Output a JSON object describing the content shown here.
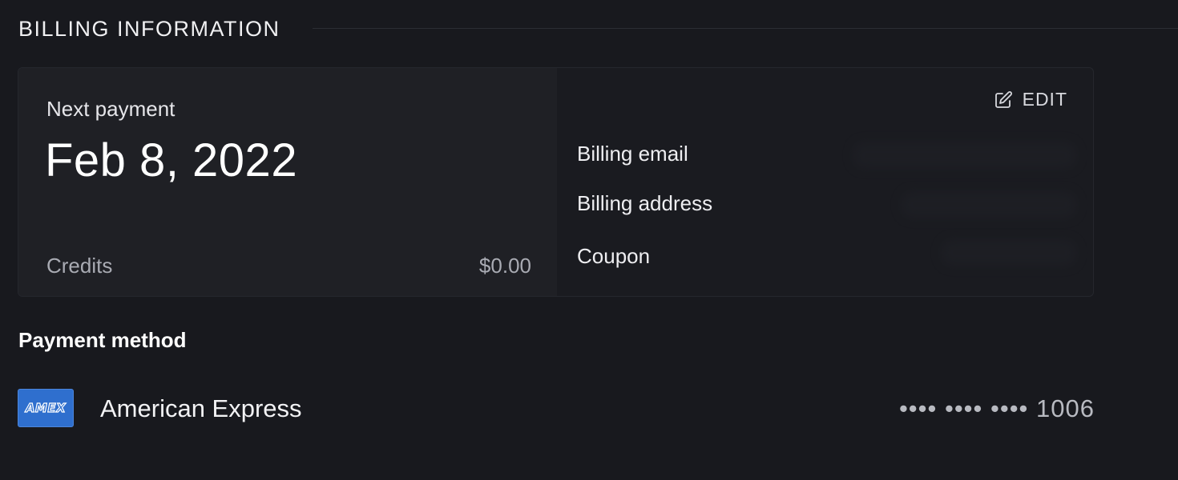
{
  "section": {
    "title": "BILLING INFORMATION"
  },
  "next_payment": {
    "label": "Next payment",
    "date": "Feb 8, 2022"
  },
  "credits": {
    "label": "Credits",
    "value": "$0.00"
  },
  "details": {
    "edit_label": "EDIT",
    "fields": [
      {
        "label": "Billing email"
      },
      {
        "label": "Billing address"
      },
      {
        "label": "Coupon"
      }
    ]
  },
  "payment_method": {
    "title": "Payment method",
    "logo_text": "AMEX",
    "brand": "American Express",
    "masked_number": "•••• •••• •••• 1006"
  },
  "colors": {
    "background": "#18191e",
    "card_left": "#1f2025",
    "card_right": "#1a1b20",
    "amex_blue": "#2f6fce"
  }
}
